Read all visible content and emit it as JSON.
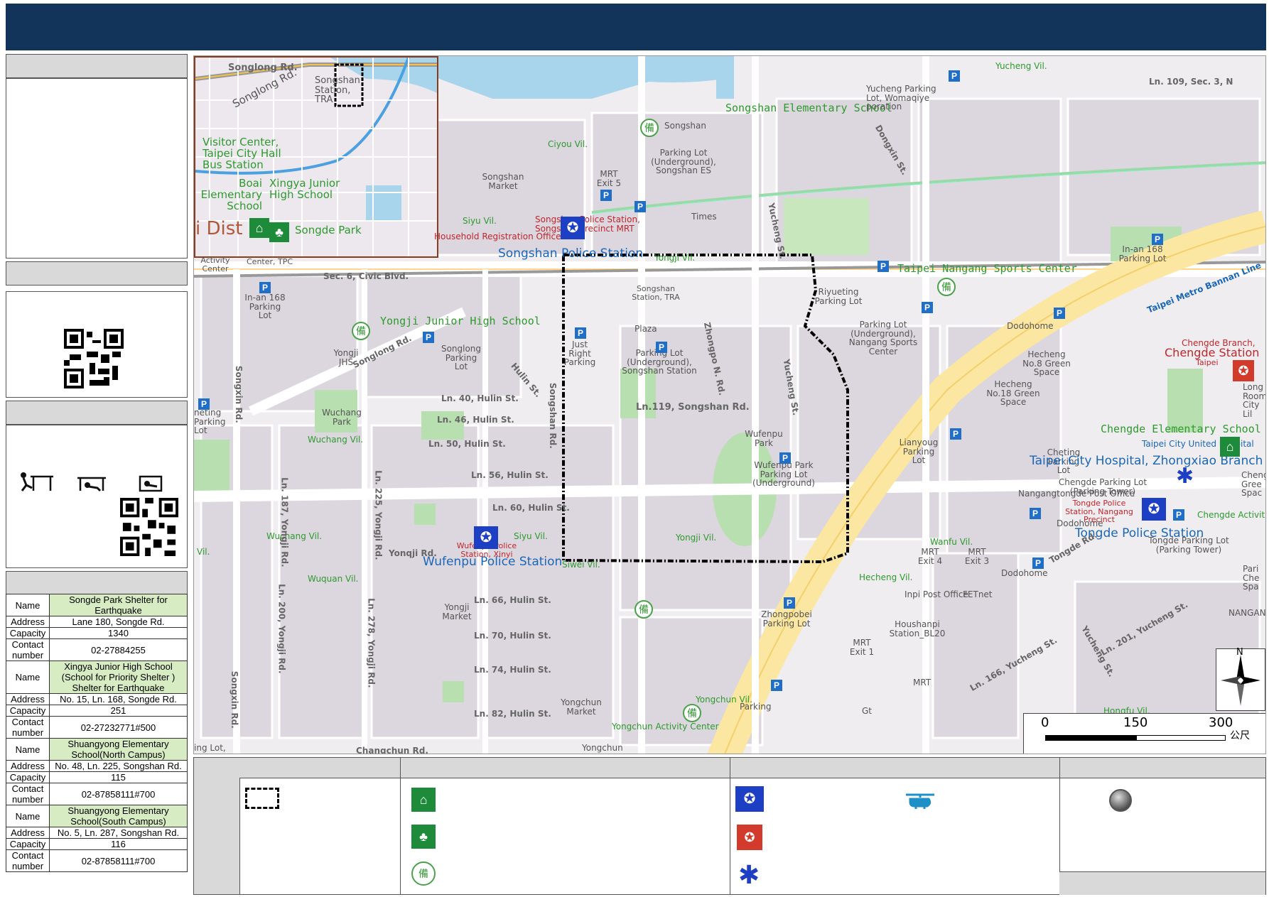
{
  "header": {
    "title": ""
  },
  "left": {
    "qr1": "qr-code",
    "qr2": "qr-code",
    "drill_icons": [
      "drop-icon",
      "cover-icon",
      "hold-on-icon"
    ],
    "shelters": [
      {
        "name_label": "Name",
        "name": "Songde Park Shelter for Earthquake",
        "address_label": "Address",
        "address": "Lane 180, Songde Rd.",
        "capacity_label": "Capacity",
        "capacity": "1340",
        "contact_label": "Contact number",
        "contact": "02-27884255"
      },
      {
        "name_label": "Name",
        "name": "Xingya Junior High School (School for Priority Shelter ) Shelter for Earthquake",
        "address_label": "Address",
        "address": "No. 15, Ln. 168, Songde Rd.",
        "capacity_label": "Capacity",
        "capacity": "251",
        "contact_label": "Contact number",
        "contact": "02-27232771#500"
      },
      {
        "name_label": "Name",
        "name": "Shuangyong Elementary School(North Campus)",
        "address_label": "Address",
        "address": "No. 48, Ln. 225, Songshan Rd.",
        "capacity_label": "Capacity",
        "capacity": "115",
        "contact_label": "Contact number",
        "contact": "02-87858111#700"
      },
      {
        "name_label": "Name",
        "name": "Shuangyong Elementary School(South Campus)",
        "address_label": "Address",
        "address": "No. 5, Ln. 287, Songshan Rd.",
        "capacity_label": "Capacity",
        "capacity": "116",
        "contact_label": "Contact number",
        "contact": "02-87858111#700"
      }
    ]
  },
  "inset": {
    "labels": [
      "Songlong Rd.",
      "Songshan Station, TRA",
      "Visitor Center, Taipei City Hall Bus Station",
      "Boai Elementary School",
      "Xingya Junior High School",
      "Songde Park",
      "i Dist"
    ]
  },
  "map": {
    "labels_green": [
      "Yucheng Vil.",
      "Songshan Elementary School",
      "Ciyou Vil.",
      "Yongji Vil.",
      "Taipei Nangang Sports Center",
      "Yongji Junior High School",
      "Wuchang Vil.",
      "Siyu Vil.",
      "Wuchang Vil.",
      "Siwei Vil.",
      "Wuquan Vil.",
      "Yongji Vil.",
      "Hecheng Vil.",
      "Wanfu Vil.",
      "Chengde Elementary School",
      "Hongfu Vil.",
      "Yongchun Vil.",
      "Siyu Vil.",
      "Yongchun Activity Center",
      "Vil."
    ],
    "labels_gray": [
      "Yucheng Parking Lot, Womaqiye poration",
      "Songshan",
      "Parking Lot (Underground), Songshan ES",
      "Songshan Market",
      "MRT Exit 5",
      "Times",
      "Household Registration Office",
      "Songshan Station, TRA",
      "Riyueting Parking Lot",
      "In-an 168 Parking Lot",
      "Dodohome",
      "Parking Lot (Underground), Nangang Sports Center",
      "In-an 168 Parking Lot",
      "Plaza",
      "Songlong Parking Lot",
      "Just Right Parking",
      "Parking Lot (Underground), Songshan Station",
      "Yongji JHS",
      "Wuchang Park",
      "Wufenpu Park",
      "Wufenpu Park Parking Lot (Underground)",
      "Lianyoug Parking Lot",
      "Hecheng No.8 Green Space",
      "Hecheng No.18 Green Space",
      "Zhongpobei Parking Lot",
      "Houshanpi Station_BL20",
      "MRT Exit 4",
      "MRT Exit 3",
      "MRT Exit 1",
      "Dodohome",
      "Dodohome",
      "FETnet",
      "Inpi Post Office",
      "Yongji Market",
      "Yongchun Market",
      "Parking",
      "MRT",
      "Center, TPC",
      "Activity Center",
      "Nangangtongde Post Office",
      "Chengde Branch,",
      "Chengde Activit",
      "Yongchun",
      "Gt",
      "ing Lot,",
      "neting Parking Lot",
      "NANGAN",
      "Long Room City Lil",
      "Pari Che Spa",
      "Cheng Gree Spac",
      "Cheting Parking Lot",
      "Chengde Parking Lot (Parking Tower)",
      "Tongde Parking Lot (Parking Tower)",
      "Songshan Police Station, Songshan Precinct MRT"
    ],
    "roads": [
      "Songlong Rd.",
      "Sec. 6, Civic Blvd.",
      "Songlong Rd.",
      "Hulin St.",
      "Ln. 40, Hulin St.",
      "Ln. 46, Hulin St.",
      "Ln. 50, Hulin St.",
      "Ln. 56, Hulin St.",
      "Ln. 60, Hulin St.",
      "Yonqji Rd.",
      "Ln. 66, Hulin St.",
      "Ln. 70, Hulin St.",
      "Ln. 74, Hulin St.",
      "Ln. 82, Hulin St.",
      "Ln.119, Songshan Rd.",
      "Songshan Rd.",
      "Zhongpo N. Rd.",
      "Yucheng St.",
      "Dongxin St.",
      "Yucheng St.",
      "Songxin Rd.",
      "Songxin Rd.",
      "Ln. 187, Yongji Rd.",
      "Ln. 225, Yongji Rd.",
      "Ln. 200, Yongji Rd.",
      "Ln. 278, Yongji Rd.",
      "Ln. 109, Sec. 3, N",
      "Taipei Metro Bannan Line",
      "Tongde Rd.",
      "Ln. 201, Yucheng St.",
      "Ln. 166, Yucheng St.",
      "Yucheng St.",
      "Changchun Rd."
    ],
    "labels_blue": [
      "Songshan Police Station",
      "Wufenpu Police Station",
      "Taipei City Hospital, Zhongxiao Branch",
      "Tongde Police Station",
      "Taipei City United Hospital"
    ],
    "labels_red": [
      "Chengde Station",
      "Wufenpu Police Station, Xinyi",
      "Tongde Police Station, Nangang Precinct",
      "Taipei"
    ],
    "scale": {
      "ticks": [
        "0",
        "150",
        "300"
      ],
      "unit": "公尺"
    },
    "north": "N"
  },
  "legend": {
    "icons": [
      "boundary-icon",
      "shelter-icon",
      "evacuation-icon",
      "bei-icon",
      "police-icon",
      "fire-station-icon",
      "hospital-icon",
      "helicopter-icon",
      "circle-icon"
    ]
  }
}
